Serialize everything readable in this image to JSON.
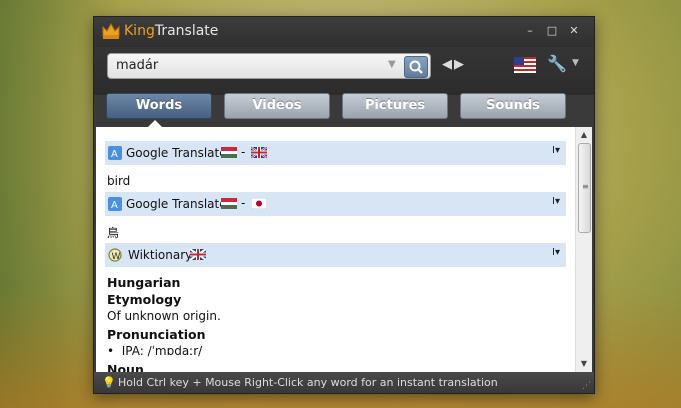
{
  "app": {
    "title_king": "King",
    "title_translate": "Translate"
  },
  "window_controls": {
    "minimize": "–",
    "maximize": "□",
    "close": "✕"
  },
  "search": {
    "value": "madár",
    "dropdown_glyph": "▼",
    "button_icon": "search-icon"
  },
  "nav": {
    "back": "◀",
    "forward": "▶"
  },
  "settings": {
    "icon": "wrench-icon",
    "dropdown_glyph": "▼"
  },
  "tabs": [
    {
      "label": "Words",
      "active": true
    },
    {
      "label": "Videos"
    },
    {
      "label": "Pictures"
    },
    {
      "label": "Sounds"
    }
  ],
  "sections": [
    {
      "source": "Google Translate",
      "dash": "-",
      "from_flag": "hungary",
      "to_flag": "uk",
      "result": "bird"
    },
    {
      "source": "Google Translate",
      "dash": "-",
      "from_flag": "hungary",
      "to_flag": "japan",
      "result": "鳥"
    },
    {
      "source": "Wiktionary",
      "flag": "uk"
    }
  ],
  "wiktionary": {
    "language": "Hungarian",
    "etymology_heading": "Etymology",
    "etymology_text": "Of unknown origin.",
    "pronunciation_heading": "Pronunciation",
    "ipa_text": "IPA: /ˈmɒdaːr/",
    "noun_heading": "Noun"
  },
  "menu_glyph": "I▾",
  "status": {
    "text": "Hold Ctrl key + Mouse Right-Click any word for an instant translation"
  },
  "colors": {
    "accent": "#f0a020",
    "active_tab": "#46617f",
    "section_bg": "#d7e5f4"
  }
}
